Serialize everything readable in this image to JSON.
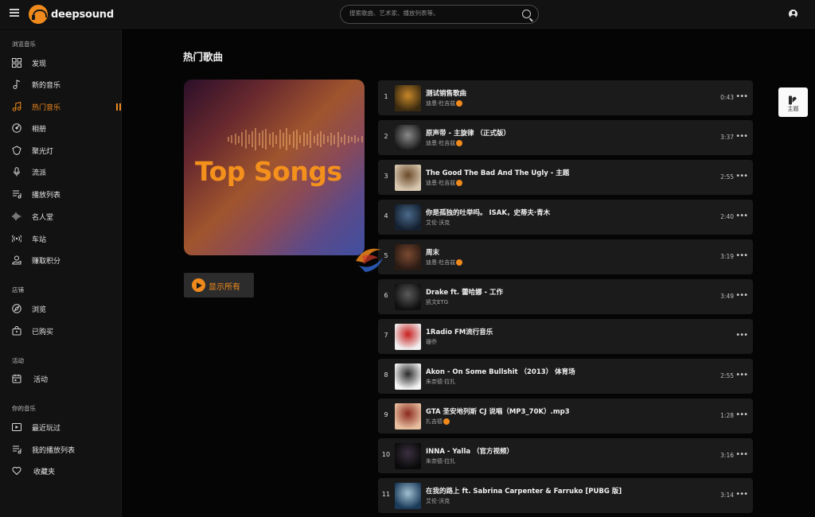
{
  "app": {
    "name": "deepsound"
  },
  "search": {
    "placeholder": "搜索歌曲、艺术家、播放列表等。"
  },
  "sidebar": {
    "browse_title": "浏览音乐",
    "browse_items": [
      {
        "label": "发现",
        "icon": "grid-icon"
      },
      {
        "label": "新的音乐",
        "icon": "music-note-icon"
      },
      {
        "label": "热门音乐",
        "icon": "music-fire-icon",
        "active": true
      },
      {
        "label": "相册",
        "icon": "disc-icon"
      },
      {
        "label": "聚光灯",
        "icon": "spotlight-icon"
      },
      {
        "label": "流派",
        "icon": "microphone-icon"
      },
      {
        "label": "播放列表",
        "icon": "playlist-icon"
      },
      {
        "label": "名人堂",
        "icon": "waveform-icon"
      },
      {
        "label": "车站",
        "icon": "radio-station-icon"
      },
      {
        "label": "赚取积分",
        "icon": "earn-points-icon"
      }
    ],
    "store_title": "店铺",
    "store_items": [
      {
        "label": "浏览",
        "icon": "browse-icon"
      },
      {
        "label": "已购买",
        "icon": "purchased-icon"
      }
    ],
    "events_title": "活动",
    "events_items": [
      {
        "label": "活动",
        "icon": "calendar-icon"
      }
    ],
    "your_music_title": "你的音乐",
    "your_music_items": [
      {
        "label": "最近玩过",
        "icon": "recent-play-icon"
      },
      {
        "label": "我的播放列表",
        "icon": "my-playlist-icon"
      },
      {
        "label": "收藏夹",
        "icon": "heart-icon"
      }
    ]
  },
  "main": {
    "title": "热门歌曲",
    "cover_title": "Top Songs",
    "show_all": "显示所有"
  },
  "tracks": [
    {
      "num": "1",
      "title": "测试销售歌曲",
      "artist": "迪恩·杜吉兹",
      "verified": true,
      "duration": "0:43",
      "art": [
        "#3a2a10",
        "#c7872a"
      ]
    },
    {
      "num": "2",
      "title": "原声带 - 主旋律 （正式版）",
      "artist": "迪恩·杜吉兹",
      "verified": true,
      "duration": "3:37",
      "art": [
        "#1a1a1a",
        "#8a8a8a"
      ]
    },
    {
      "num": "3",
      "title": "The Good The Bad And The Ugly - 主题",
      "artist": "迪恩·杜吉兹",
      "verified": true,
      "duration": "2:55",
      "art": [
        "#d8c8b0",
        "#6a4a2a"
      ]
    },
    {
      "num": "4",
      "title": "你是孤独的吐举吗。 ISAK，史蒂夫·青木",
      "artist": "艾伦·沃克",
      "verified": false,
      "duration": "2:40",
      "art": [
        "#142030",
        "#4a6a8a"
      ]
    },
    {
      "num": "5",
      "title": "周末",
      "artist": "迪恩·杜吉兹",
      "verified": true,
      "duration": "3:19",
      "art": [
        "#2a1a14",
        "#7a4a30"
      ]
    },
    {
      "num": "6",
      "title": "Drake ft. 蕾哈娜 - 工作",
      "artist": "凯文ETG",
      "verified": false,
      "duration": "3:49",
      "art": [
        "#101010",
        "#5a5a5a"
      ]
    },
    {
      "num": "7",
      "title": "1Radio FM流行音乐",
      "artist": "珊乔",
      "verified": false,
      "duration": "",
      "art": [
        "#f0f0f0",
        "#c82020"
      ]
    },
    {
      "num": "8",
      "title": "Akon - On Some Bullshit （2013） 体育场",
      "artist": "朱奈德·拉扎",
      "verified": false,
      "duration": "2:55",
      "art": [
        "#f4f4f4",
        "#2a2a2a"
      ]
    },
    {
      "num": "9",
      "title": "GTA 圣安地列斯 CJ 说唱（MP3_70K）.mp3",
      "artist": "扎吉德",
      "verified": true,
      "duration": "1:28",
      "art": [
        "#e8c0a0",
        "#8a2a20"
      ]
    },
    {
      "num": "10",
      "title": "INNA - Yalla （官方视频）",
      "artist": "朱奈德·拉扎",
      "verified": false,
      "duration": "3:16",
      "art": [
        "#0a0a0a",
        "#3a3040"
      ]
    },
    {
      "num": "11",
      "title": "在我的路上 ft. Sabrina Carpenter & Farruko [PUBG 版]",
      "artist": "艾伦·沃克",
      "verified": false,
      "duration": "3:14",
      "art": [
        "#1a3a5a",
        "#a0c0d0"
      ]
    }
  ],
  "theme_button": {
    "label": "主题"
  },
  "colors": {
    "accent": "#f08a1c",
    "background": "#050505",
    "panel": "#121212",
    "row": "#1b1b1b"
  }
}
